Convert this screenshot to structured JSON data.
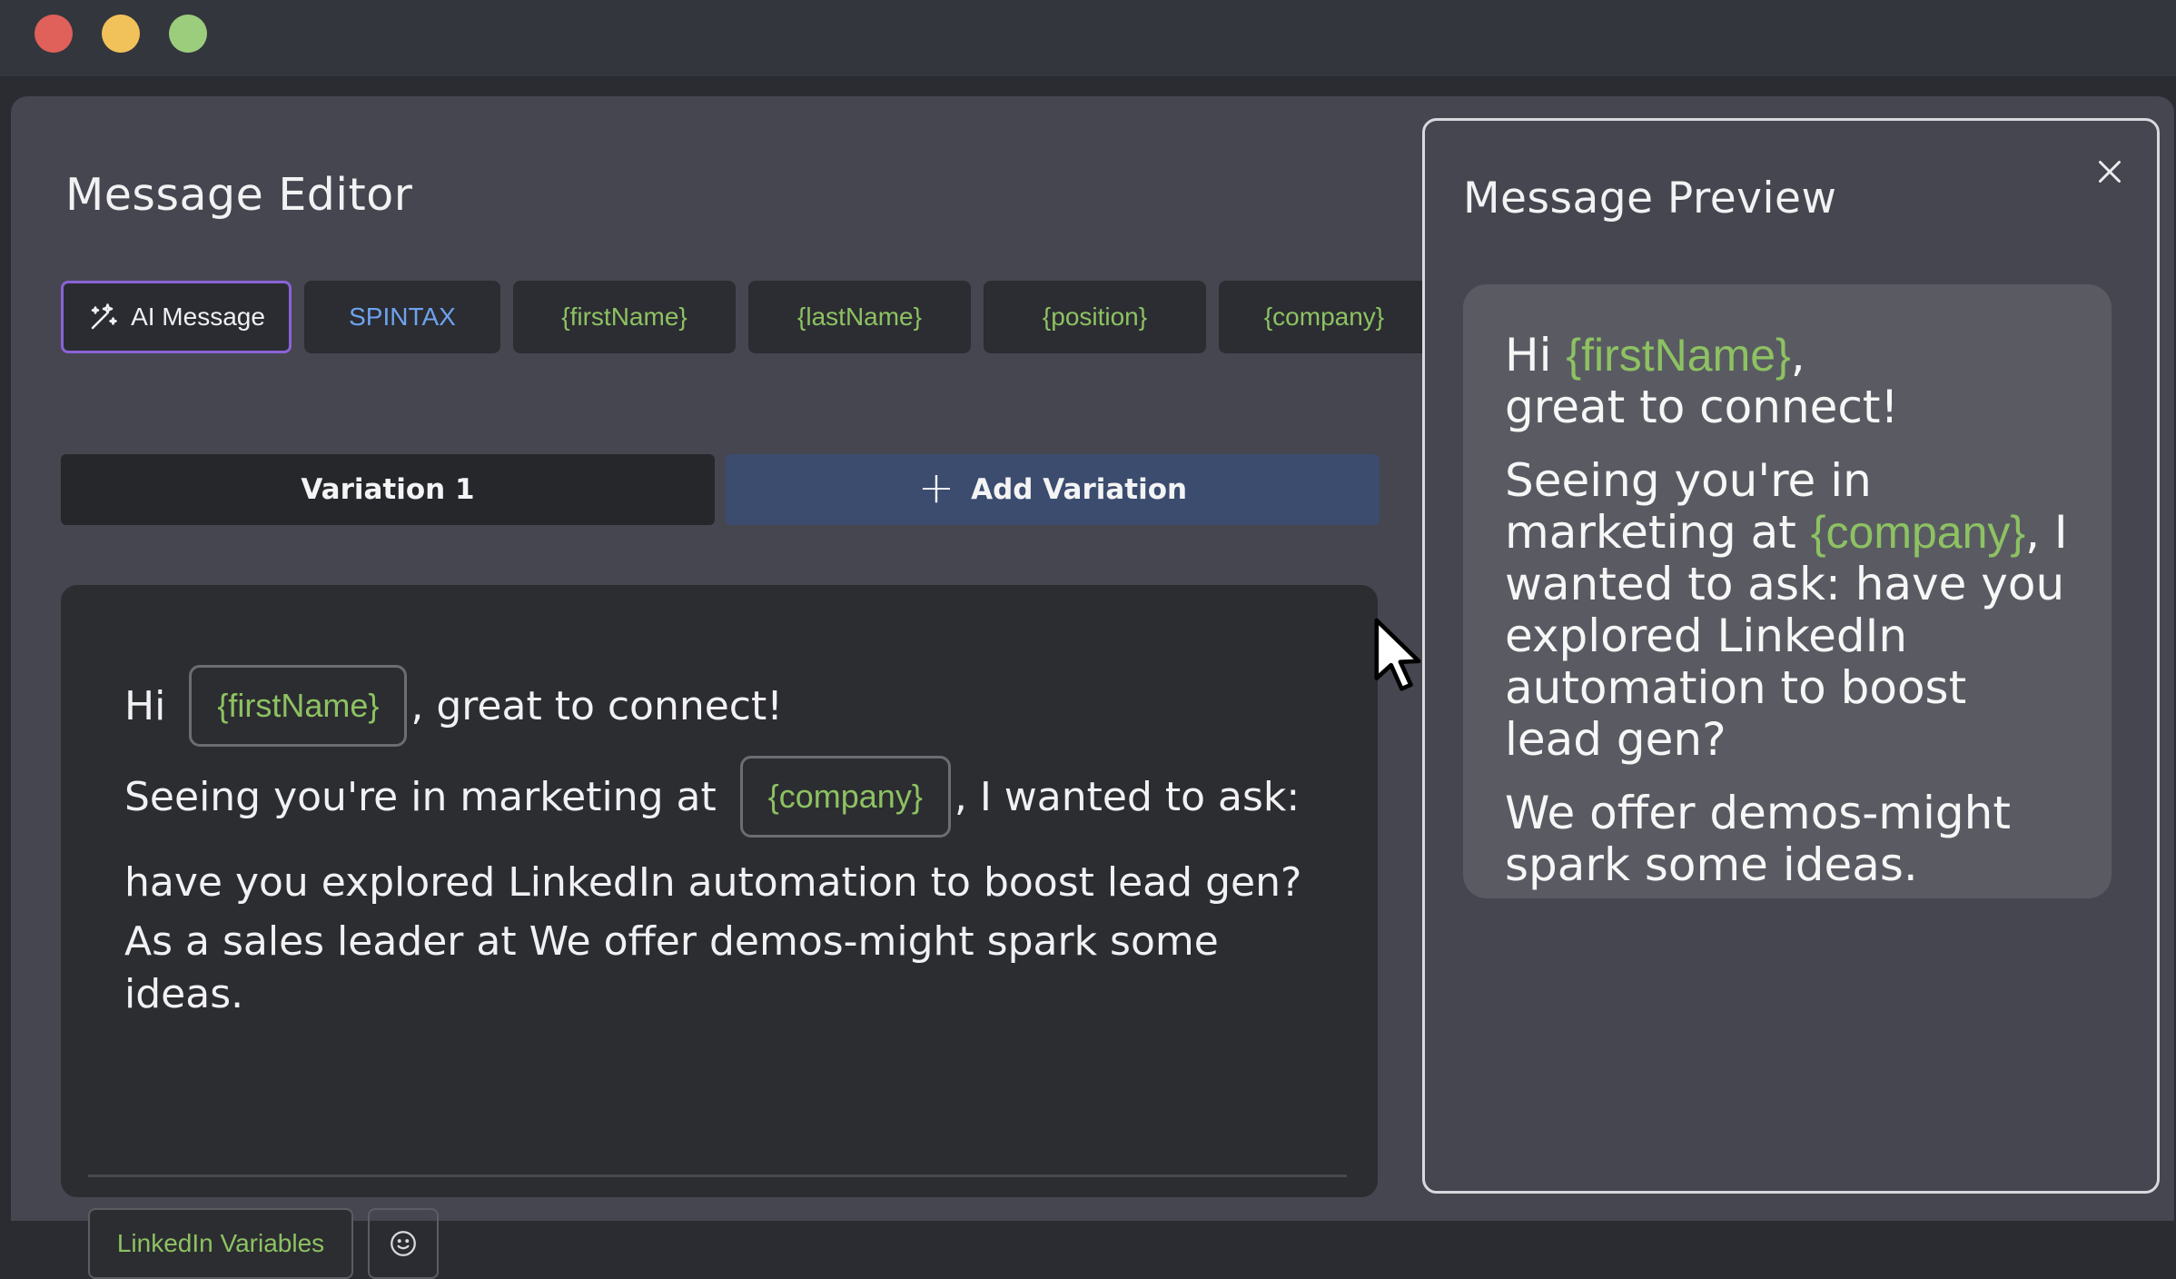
{
  "window": {
    "controls": [
      "close",
      "minimize",
      "maximize"
    ]
  },
  "editor": {
    "title": "Message Editor",
    "chips": {
      "ai_message": "AI Message",
      "spintax": "SPINTAX",
      "first_name": "{firstName}",
      "last_name": "{lastName}",
      "position": "{position}",
      "company": "{company}"
    },
    "variation_tab": "Variation 1",
    "add_variation": "Add Variation",
    "message": {
      "line1_before": "Hi",
      "line1_token": "{firstName}",
      "line1_after": ", great to connect!",
      "line2_before": "Seeing you're in marketing at",
      "line2_token": "{company}",
      "line2_after": ", I wanted to ask:",
      "line3": "have you explored LinkedIn automation to boost lead gen?",
      "line4": "As a sales leader at  We offer demos-might spark some ideas."
    },
    "linkedin_variables_label": "LinkedIn Variables"
  },
  "preview": {
    "title": "Message Preview",
    "p1_hi": "Hi",
    "p1_var": "{firstName}",
    "p1_comma": ",",
    "p1_rest": "great to connect!",
    "p2_before": "Seeing you're in marketing at",
    "p2_var": "{company}",
    "p2_after": ", I wanted to ask: have you explored LinkedIn automation to boost lead gen?",
    "p3": "We offer demos-might spark some ideas."
  },
  "colors": {
    "variable_green": "#8dc262",
    "spintax_blue": "#6ea3ee",
    "ai_border_purple": "#8a62d6",
    "add_variation_bg": "#3b4c6e"
  },
  "icons": [
    "sparkle-wand-icon",
    "plus-icon",
    "smiley-icon",
    "close-icon",
    "mouse-pointer-icon"
  ]
}
